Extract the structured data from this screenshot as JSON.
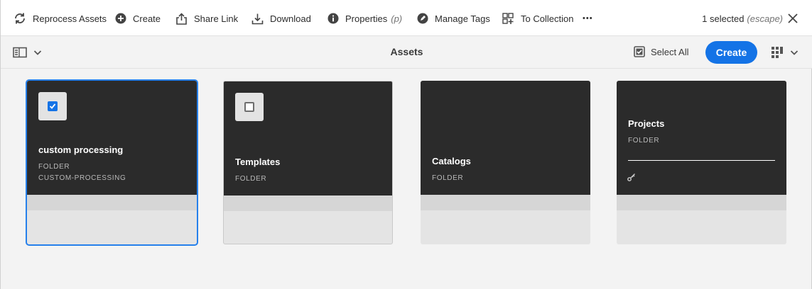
{
  "actionbar": {
    "reprocess": "Reprocess Assets",
    "create": "Create",
    "share": "Share Link",
    "download": "Download",
    "properties": "Properties",
    "properties_hint": "(p)",
    "manage_tags": "Manage Tags",
    "to_collection": "To Collection",
    "more": "•••",
    "selected_count": "1 selected",
    "escape_hint": "(escape)"
  },
  "titlebar": {
    "title": "Assets",
    "select_all": "Select All",
    "create_label": "Create"
  },
  "cards": [
    {
      "name": "custom processing",
      "type": "FOLDER",
      "path": "CUSTOM-PROCESSING",
      "selected": true
    },
    {
      "name": "Templates",
      "type": "FOLDER",
      "selected": false
    },
    {
      "name": "Catalogs",
      "type": "FOLDER"
    },
    {
      "name": "Projects",
      "type": "FOLDER"
    }
  ],
  "colors": {
    "accent": "#1473e6",
    "card_dark": "#2b2b2b",
    "selection_outline": "#2680eb"
  }
}
